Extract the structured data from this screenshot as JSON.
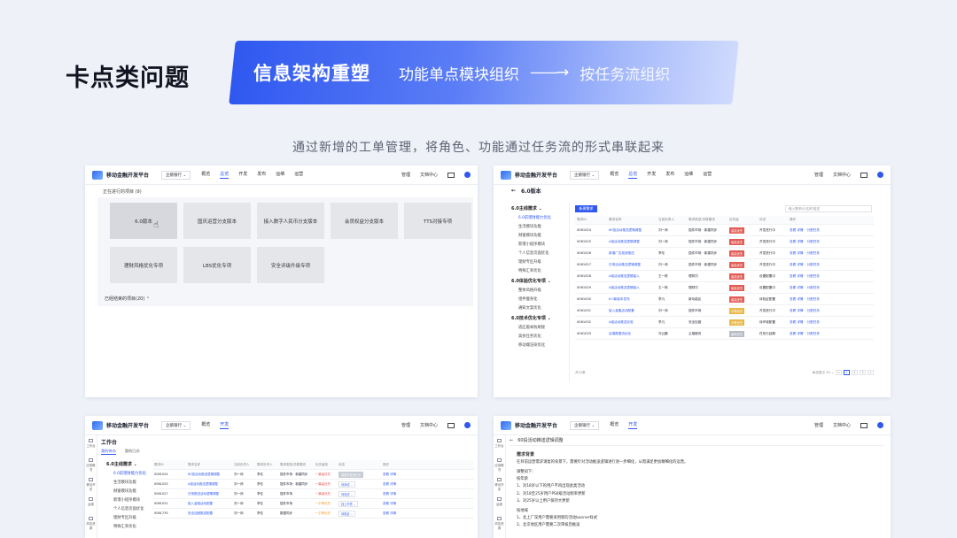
{
  "slide": {
    "title": "卡点类问题",
    "banner_main": "信息架构重塑",
    "banner_from": "功能单点模块组织",
    "banner_arrow": "——→",
    "banner_to": "按任务流组织",
    "subtitle": "通过新增的工单管理，将角色、功能通过任务流的形式串联起来"
  },
  "app": {
    "name": "移动金融开发平台",
    "selector": "企鹅银行 ⌄",
    "nav": [
      "概览",
      "总览",
      "开发",
      "发布",
      "运维",
      "运营"
    ],
    "right": [
      "管理",
      "文档中心"
    ]
  },
  "panel1": {
    "heading": "正在进行的项目 (9)",
    "tiles": [
      "6.0版本",
      "国庆运营分支版本",
      "接入数字人民币分支版本",
      "会员权益分支版本",
      "TTS对接专项",
      "理财风格优化专项",
      "LBS优化专项",
      "安全评级升级专项"
    ],
    "footer": "已经结束的项目(20) ⌃"
  },
  "panel2": {
    "back_title": "6.0版本",
    "new_button": "新建需求",
    "search_placeholder": "输入需求ID/名称/描述",
    "groups": [
      {
        "label": "6.0主线需求 ⌄",
        "items": [
          "6.0前理财能力优化",
          "生活模块功能",
          "财富模块功能",
          "新增小程序模块",
          "个人信息页面优化",
          "理财专区升级",
          "特殊汇率优化"
        ]
      },
      {
        "label": "6.0体验优化专项 ⌄",
        "items": [
          "整体风格升级",
          "组件瘦身化",
          "通知文案优化"
        ]
      },
      {
        "label": "6.0技术优化专项 ⌄",
        "items": [
          "适应版本防刷接",
          "高抗任务优化",
          "移动端渲染优化"
        ]
      }
    ],
    "columns": [
      "需求ID",
      "需求名称",
      "当前负责人",
      "需求类型/关联模块",
      "优先级",
      "状态",
      "操作"
    ],
    "rows": [
      {
        "id": "0061024",
        "name": "60投活动推送逻辑调整",
        "owner": "刘一帅",
        "module": "插件市场 · 新建同步",
        "priority": "最高优先",
        "level": "red",
        "status": "开发进行中",
        "ops": "查看 详情 ･ 分配任务"
      },
      {
        "id": "0061025",
        "name": "A组活动推送逻辑调整",
        "owner": "刘一帅",
        "module": "插件市场 · 新建同步",
        "priority": "最高优先",
        "level": "red",
        "status": "开发进行中",
        "ops": "查看 详情 ･ 分配任务"
      },
      {
        "id": "0061026",
        "name": "新增广告投放推送",
        "owner": "李伦",
        "module": "插件市场 · 新建同步",
        "priority": "最高优先",
        "level": "red",
        "status": "开发进行中",
        "ops": "查看 详情 ･ 分配任务"
      },
      {
        "id": "0061027",
        "name": "日常活动推送逻辑调整",
        "owner": "刘一帅",
        "module": "插件市场 · 新建同步",
        "priority": "最高优先",
        "level": "red",
        "status": "开发进行中",
        "ops": "查看 详情 ･ 分配任务"
      },
      {
        "id": "0061028",
        "name": "A组活动推送逻辑接入",
        "owner": "王一帆",
        "module": "理财坊",
        "priority": "最高优先",
        "level": "red",
        "status": "设置配置中",
        "ops": "查看 详情 ･ 分配任务"
      },
      {
        "id": "0061029",
        "name": "A组活动推送逻辑接入",
        "owner": "王一帆",
        "module": "理财坊",
        "priority": "最高优先",
        "level": "red",
        "status": "设置配置中",
        "ops": "查看 详情 ･ 分配任务"
      },
      {
        "id": "0061030",
        "name": "6.0新版本发布",
        "owner": "李凡",
        "module": "新功能区",
        "priority": "最高优先",
        "level": "red",
        "status": "待验证配置",
        "ops": "查看 详情 ･ 分配任务"
      },
      {
        "id": "0061031",
        "name": "接入金融活动配置",
        "owner": "刘一帅",
        "module": "插件市场",
        "priority": "中等优先",
        "level": "yellow",
        "status": "开发进行中",
        "ops": "查看 详情 ･ 分配任务"
      },
      {
        "id": "0061032",
        "name": "A组活动推送实验",
        "owner": "李凡",
        "module": "安全加固",
        "priority": "中等优先",
        "level": "yellow",
        "status": "待环境配置",
        "ops": "查看 详情 ･ 分配任务"
      },
      {
        "id": "0061033",
        "name": "后端数据流优化",
        "owner": "冯云鹏",
        "module": "云端服务",
        "priority": "最低优先",
        "level": "grey",
        "status": "任务已延期",
        "ops": "查看 详情 ･ 分配任务"
      }
    ],
    "pager_total": "共10条",
    "pager_size": "每页显示 10 ⌄",
    "pager_pages": [
      "<",
      "1",
      "2",
      "3",
      ">"
    ],
    "pager_jump": "1/2"
  },
  "panel3": {
    "rail": [
      "工作台",
      "应用概况",
      "移动开发",
      "运维",
      "风控资源"
    ],
    "title": "工作台",
    "tabs": [
      "我的待办",
      "我的已办"
    ],
    "group": "6.0主线需求 ⌄",
    "side_items": [
      "6.0前理财能力优化",
      "生活模块功能",
      "财富模块功能",
      "新增小程序模块",
      "个人信息页面优化",
      "理财专区升级",
      "特殊汇率优化"
    ],
    "columns": [
      "需求ID",
      "需求名称",
      "当前负责人",
      "需求负责人",
      "需求类型/关联模块",
      "优先级别",
      "状态",
      "操作"
    ],
    "rows": [
      {
        "id": "0061024",
        "name": "60投活动推送逻辑调整",
        "owner": "刘一帅",
        "lead": "李伦",
        "module": "插件市场 · 新建同步",
        "priority": "• 最高优先",
        "risk": "high",
        "status": "需求开发进行中",
        "status_grey": true,
        "ops": "查看 详情"
      },
      {
        "id": "0061025",
        "name": "A组活动推送逻辑调整",
        "owner": "刘一帅",
        "lead": "李伦",
        "module": "插件市场 · 新建同步",
        "priority": "• 最高优先",
        "risk": "high",
        "status": "待测试 ⌄",
        "status_grey": false,
        "ops": "查看 详情"
      },
      {
        "id": "0061027",
        "name": "日常推送活动逻辑调整",
        "owner": "刘一帅",
        "lead": "李伦",
        "module": "插件市场",
        "priority": "• 最高优先",
        "risk": "high",
        "status": "待测试 ⌄",
        "status_grey": false,
        "ops": "查看 详情"
      },
      {
        "id": "0061031",
        "name": "接入金融活动配置",
        "owner": "刘一帅",
        "lead": "李伦",
        "module": "插件市场",
        "priority": "• 中等优先",
        "risk": "warn",
        "status": "线上环境 ⌄",
        "status_grey": false,
        "ops": "查看 详情"
      },
      {
        "id": "0061735",
        "name": "安全加固推送配置",
        "owner": "刘一帅",
        "lead": "李伦",
        "module": "数据同步",
        "priority": "• 中等优先",
        "risk": "warn",
        "status": "待验证 ⌄",
        "status_grey": false,
        "ops": "查看 详情"
      }
    ]
  },
  "panel4": {
    "back_title": "60投活动推送逻辑调整",
    "section1": "需求背景",
    "bg_text": "在目前运营需求请复的背景下，需要针对活动推送逻辑进行进一步细化，从而满足更加精细化的运营。",
    "section2": "调整如下：",
    "sub1": "按年龄",
    "lines1": [
      "1、对18岁以下的用户不再出现此类活动",
      "2、对18至25岁用户PS6级活动频率更新",
      "3、对25岁以上用户保持大更新"
    ],
    "sub2": "按地域",
    "lines2": [
      "1、北上广深用户需要采用新的活动banner样式",
      "2、北京地区用户需要二次审核后推送"
    ]
  },
  "colors": {
    "accent": "#2f58f0",
    "danger": "#e25b55",
    "warning": "#e9b848",
    "muted": "#b7bbc4"
  }
}
